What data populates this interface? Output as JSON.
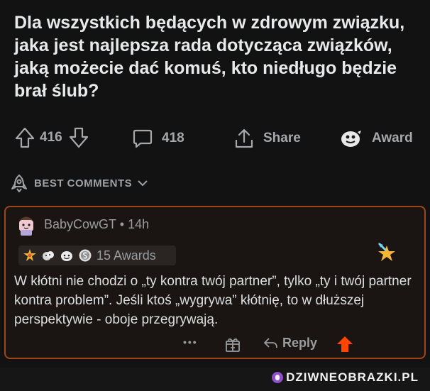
{
  "post": {
    "title": "Dla wszystkich będących w zdrowym związku, jaka jest najlepsza rada dotycząca związków, jaką możecie dać komuś, kto niedługo będzie brał ślub?",
    "votes": "416",
    "comments_count": "418",
    "share_label": "Share",
    "award_label": "Award"
  },
  "sort": {
    "label": "BEST COMMENTS"
  },
  "comment": {
    "username": "BabyCowGT",
    "separator": "•",
    "time": "14h",
    "awards_text": "15 Awards",
    "body": "W kłótni nie chodzi o „ty kontra twój partner”, tylko „ty i twój partner kontra problem”. Jeśli ktoś „wygrywa” kłótnię, to w dłuższej perspektywie - oboje przegrywają.",
    "more_label": "•••",
    "reply_label": "Reply"
  },
  "watermark": {
    "text": "DZIWNEOBRAZKI.PL"
  },
  "colors": {
    "upvote": "#ff4500",
    "border": "#a0451a",
    "background": "#121212"
  }
}
